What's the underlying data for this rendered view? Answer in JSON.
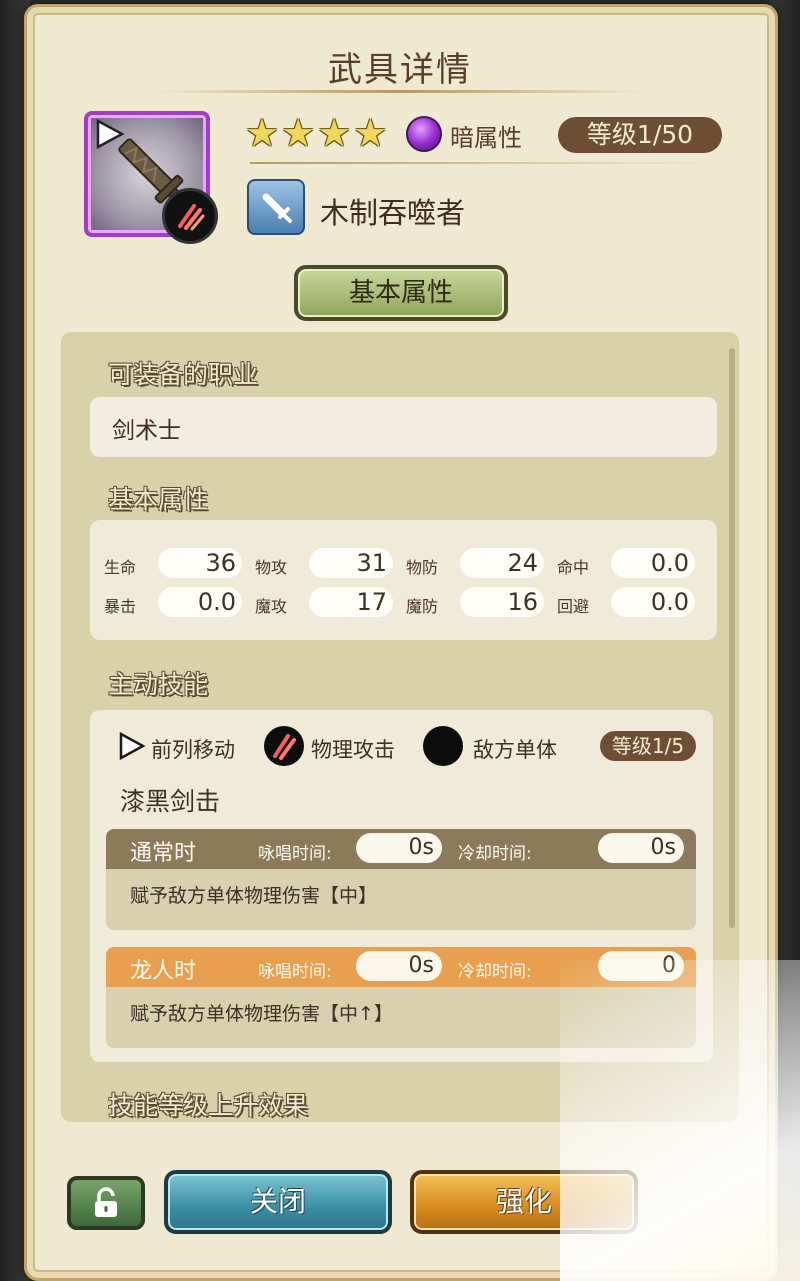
{
  "dialog": {
    "title": "武具详情",
    "tab_label": "基本属性"
  },
  "weapon": {
    "stars": 4,
    "star_glyph": "★",
    "element_label": "暗属性",
    "level_label": "等级1/50",
    "name": "木制吞噬者"
  },
  "sections": {
    "equip_class_title": "可装备的职业",
    "equip_class_value": "剑术士",
    "base_stats_title": "基本属性",
    "active_skill_title": "主动技能",
    "level_up_title": "技能等级上升效果"
  },
  "stats": [
    {
      "label": "生命",
      "value": "36"
    },
    {
      "label": "物攻",
      "value": "31"
    },
    {
      "label": "物防",
      "value": "24"
    },
    {
      "label": "命中",
      "value": "0.0"
    },
    {
      "label": "暴击",
      "value": "0.0"
    },
    {
      "label": "魔攻",
      "value": "17"
    },
    {
      "label": "魔防",
      "value": "16"
    },
    {
      "label": "回避",
      "value": "0.0"
    }
  ],
  "skill": {
    "tags": [
      "前列移动",
      "物理攻击",
      "敌方单体"
    ],
    "level_label": "等级1/5",
    "name": "漆黑剑击",
    "modes": [
      {
        "name": "通常时",
        "cast_label": "咏唱时间:",
        "cast_value": "0s",
        "cooldown_label": "冷却时间:",
        "cooldown_value": "0s",
        "description": "赋予敌方单体物理伤害【中】"
      },
      {
        "name": "龙人时",
        "cast_label": "咏唱时间:",
        "cast_value": "0s",
        "cooldown_label": "冷却时间:",
        "cooldown_value": "0",
        "description": "赋予敌方单体物理伤害【中↑】"
      }
    ]
  },
  "buttons": {
    "close_label": "关闭",
    "upgrade_label": "强化"
  },
  "colors": {
    "panel_bg": "#f0e9d2",
    "element_dark": "#9b2fd4",
    "normal_mode_header": "#8c7a5a",
    "dragon_mode_header": "#e8a050",
    "close_button": "#3a8fa5",
    "upgrade_button": "#d78a1f"
  },
  "icons": [
    "play-icon",
    "claw-slash-icon",
    "sword-type-icon",
    "dark-element-orb-icon",
    "lock-icon"
  ]
}
